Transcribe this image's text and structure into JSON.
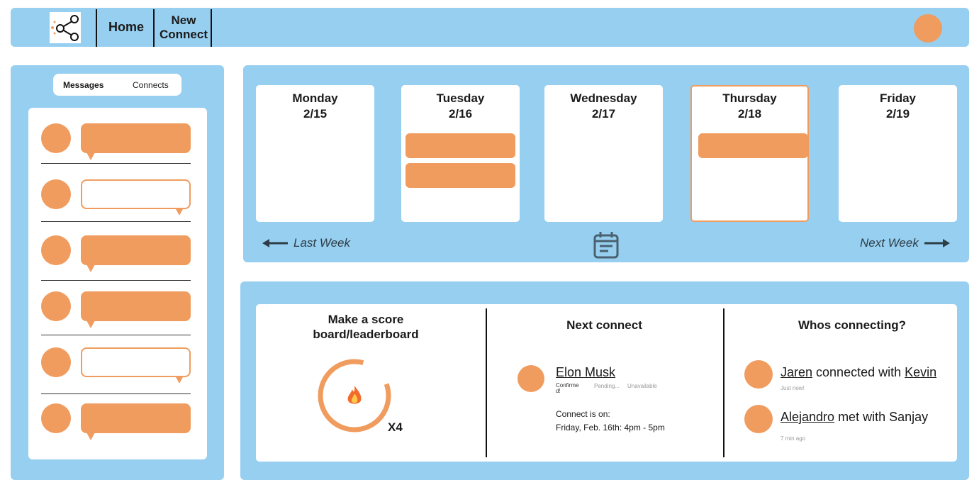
{
  "header": {
    "nav": [
      {
        "label": "Home"
      },
      {
        "label": "New Connect"
      }
    ],
    "icons": {
      "logo": "share-icon",
      "profile": "avatar"
    }
  },
  "sidebar": {
    "tabs": [
      {
        "label": "Messages",
        "active": true
      },
      {
        "label": "Connects",
        "active": false
      }
    ],
    "messages": [
      {
        "style": "filled"
      },
      {
        "style": "outline"
      },
      {
        "style": "filled"
      },
      {
        "style": "filled"
      },
      {
        "style": "outline"
      },
      {
        "style": "filled"
      }
    ]
  },
  "calendar": {
    "days": [
      {
        "name": "Monday",
        "date": "2/15",
        "events": 0,
        "selected": false
      },
      {
        "name": "Tuesday",
        "date": "2/16",
        "events": 2,
        "selected": false
      },
      {
        "name": "Wednesday",
        "date": "2/17",
        "events": 0,
        "selected": false
      },
      {
        "name": "Thursday",
        "date": "2/18",
        "events": 1,
        "selected": true
      },
      {
        "name": "Friday",
        "date": "2/19",
        "events": 0,
        "selected": false
      }
    ],
    "prev_label": "Last Week",
    "next_label": "Next Week"
  },
  "scoreboard": {
    "title_line1": "Make a score",
    "title_line2": "board/leaderboard",
    "streak": "X4",
    "icon": "fire-icon"
  },
  "next_connect": {
    "title": "Next connect",
    "name": "Elon Musk",
    "statuses": [
      "Confirme\nd!",
      "Pending...",
      "Unavailable"
    ],
    "on_label": "Connect is on:",
    "when": "Friday, Feb. 16th: 4pm - 5pm"
  },
  "whos_connecting": {
    "title": "Whos connecting?",
    "items": [
      {
        "name1": "Jaren",
        "verb": " connected with ",
        "name2": "Kevin",
        "time": "Just now!"
      },
      {
        "name1": "Alejandro",
        "verb": " met with Sanjay",
        "name2": "",
        "time": "7 min ago"
      }
    ]
  },
  "colors": {
    "accent": "#f09c5e",
    "panel": "#97cff0",
    "text": "#1a1a1a"
  }
}
